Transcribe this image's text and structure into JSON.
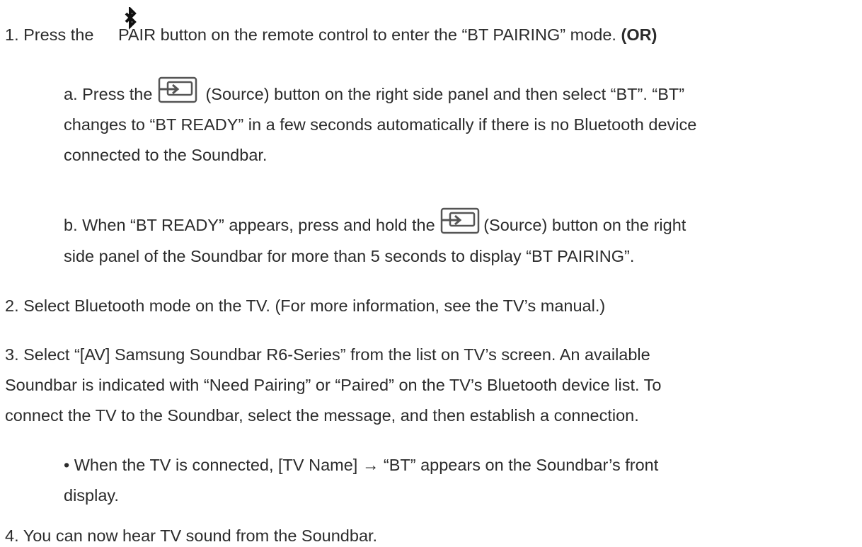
{
  "steps": {
    "step1": {
      "prefix": "1. Press the ",
      "icon": "bluetooth-icon",
      "suffix": "PAIR button on the remote control to enter the “BT PAIRING” mode. ",
      "or": "(OR)"
    },
    "step1a": {
      "prefix": "a. Press the ",
      "icon": "source-icon",
      "line1_suffix": " (Source) button on the right side panel and then select “BT”. “BT”",
      "line2": "changes to “BT READY” in a few seconds automatically if there is no Bluetooth device",
      "line3": "connected to the Soundbar."
    },
    "step1b": {
      "prefix": "b. When “BT READY” appears, press and hold the ",
      "icon": "source-icon",
      "line1_suffix": "(Source) button on the right",
      "line2": "side panel of the Soundbar for more than 5 seconds to display “BT PAIRING”."
    },
    "step2": "2. Select Bluetooth mode on the TV. (For more information, see the TV’s manual.)",
    "step3": {
      "line1": "3. Select “[AV] Samsung Soundbar R6-Series” from the list on TV’s screen. An available",
      "line2": "Soundbar is indicated with “Need Pairing” or “Paired” on the TV’s Bluetooth device list. To",
      "line3": "connect the TV to the Soundbar, select the message, and then establish a connection."
    },
    "bullet": {
      "line1": "• When the TV is connected, [TV Name] → “BT” appears on the Soundbar’s front",
      "line2": "display."
    },
    "step4": "4. You can now hear TV sound from the Soundbar."
  }
}
